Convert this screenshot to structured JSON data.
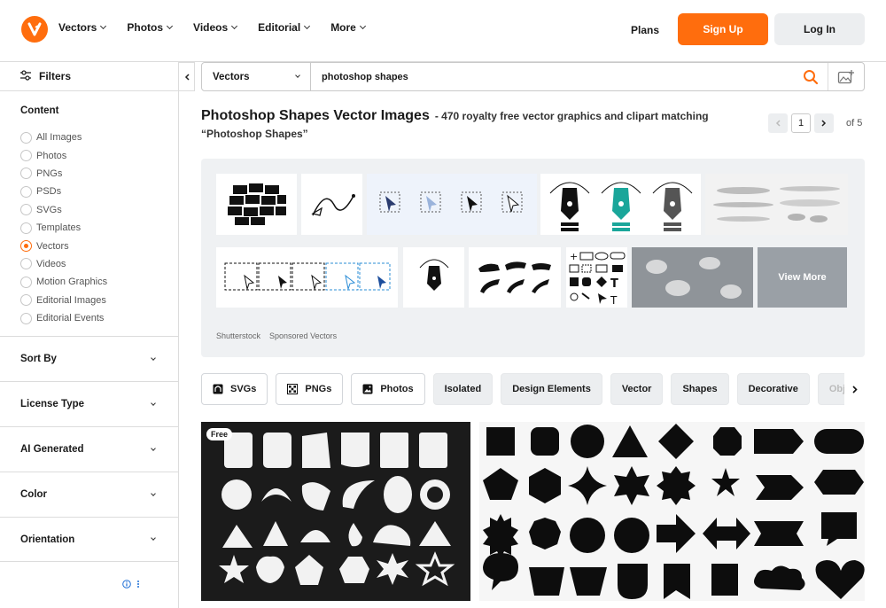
{
  "header": {
    "logo_glyph": "V",
    "nav": [
      {
        "label": "Vectors"
      },
      {
        "label": "Photos"
      },
      {
        "label": "Videos"
      },
      {
        "label": "Editorial"
      },
      {
        "label": "More"
      }
    ],
    "plans": "Plans",
    "signup": "Sign Up",
    "login": "Log In",
    "accent": "#ff6d0d"
  },
  "sidebar": {
    "filters_label": "Filters",
    "content_heading": "Content",
    "content_options": [
      {
        "label": "All Images",
        "selected": false
      },
      {
        "label": "Photos",
        "selected": false
      },
      {
        "label": "PNGs",
        "selected": false
      },
      {
        "label": "PSDs",
        "selected": false
      },
      {
        "label": "SVGs",
        "selected": false
      },
      {
        "label": "Templates",
        "selected": false
      },
      {
        "label": "Vectors",
        "selected": true
      },
      {
        "label": "Videos",
        "selected": false
      },
      {
        "label": "Motion Graphics",
        "selected": false
      },
      {
        "label": "Editorial Images",
        "selected": false
      },
      {
        "label": "Editorial Events",
        "selected": false
      }
    ],
    "accordions": [
      {
        "label": "Sort By"
      },
      {
        "label": "License Type"
      },
      {
        "label": "AI Generated"
      },
      {
        "label": "Color"
      },
      {
        "label": "Orientation"
      }
    ]
  },
  "search": {
    "type": "Vectors",
    "query": "photoshop shapes"
  },
  "results_header": {
    "title": "Photoshop Shapes Vector Images",
    "subtitle": "- 470 royalty free vector graphics and clipart matching",
    "query_quoted": "“Photoshop Shapes”",
    "page": "1",
    "of_pages": "of 5"
  },
  "sponsored": {
    "source": "Shutterstock",
    "label": "Sponsored Vectors",
    "view_more": "View More"
  },
  "chips": [
    {
      "label": "SVGs",
      "icon": "svg-icon",
      "style": "outline"
    },
    {
      "label": "PNGs",
      "icon": "png-icon",
      "style": "outline"
    },
    {
      "label": "Photos",
      "icon": "photo-icon",
      "style": "outline"
    },
    {
      "label": "Isolated",
      "style": "fill"
    },
    {
      "label": "Design Elements",
      "style": "fill"
    },
    {
      "label": "Vector",
      "style": "fill"
    },
    {
      "label": "Shapes",
      "style": "fill"
    },
    {
      "label": "Decorative",
      "style": "fill"
    },
    {
      "label": "Objects",
      "style": "fill"
    }
  ],
  "results": [
    {
      "badge": "Free"
    }
  ]
}
